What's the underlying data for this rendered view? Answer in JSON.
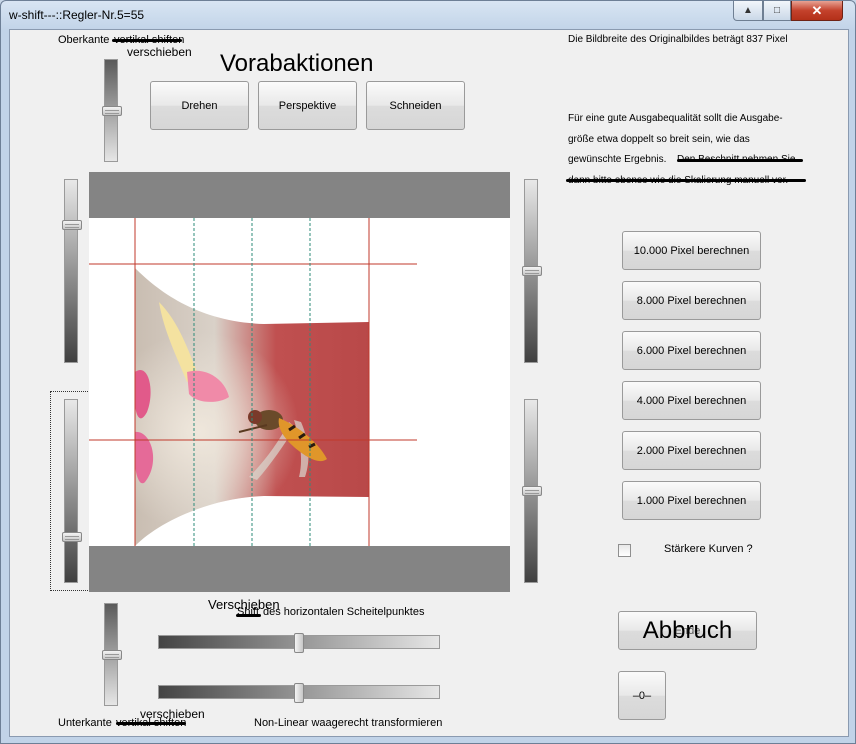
{
  "window": {
    "title": "w-shift---::Regler-Nr.5=55",
    "min_icon": "▲",
    "max_icon": "□",
    "close_icon": "✕"
  },
  "labels": {
    "oberkante": "Oberkante",
    "oberkante_strike": "vertikal shiften",
    "oberkante_new": "verschieben",
    "vorabaktionen": "Vorabaktionen",
    "info_width": "Die Bildbreite des Originalbildes beträgt 837 Pixel",
    "quality_line1": "Für eine gute Ausgabequalität sollt die Ausgabe-",
    "quality_line2": "größe etwa doppelt so breit sein, wie das",
    "quality_line3a": "gewünschte Ergebnis.",
    "quality_line3b": "Den Beschnitt nehmen Sie",
    "quality_line4": "dann bitte ebenso wie die Skalierung manuell vor.",
    "shift_new": "Verschieben",
    "shift_label_strike": "Shift",
    "shift_label_rest": "des horizontalen Scheitelpunktes",
    "unterkante": "Unterkante",
    "unterkante_strike": "vertikal shiften",
    "unterkante_new": "verschieben",
    "nonlinear": "Non-Linear waagerecht transformieren",
    "staerkere_kurven": "Stärkere Kurven ?"
  },
  "buttons": {
    "drehen": "Drehen",
    "perspektive": "Perspektive",
    "schneiden": "Schneiden",
    "px10000": "10.000 Pixel berechnen",
    "px8000": "8.000 Pixel berechnen",
    "px6000": "6.000 Pixel berechnen",
    "px4000": "4.000 Pixel berechnen",
    "px2000": "2.000 Pixel berechnen",
    "px1000": "1.000 Pixel berechnen",
    "abbruch": "Abbruch",
    "abbruch_under": "Ende",
    "reset": "–0–"
  },
  "sliders": {
    "top_vertical_level": 0.5,
    "left_upper_level": 0.23,
    "left_lower_level": 0.77,
    "right_upper_level": 0.5,
    "right_lower_level": 0.5,
    "bottom_vertical_level": 0.5,
    "h_shift_level": 0.5,
    "h_nonlinear_level": 0.5
  },
  "checkbox": {
    "staerkere_kurven_checked": false
  },
  "colors": {
    "guide_red": "#c0392b",
    "guide_teal": "#2e8b7a",
    "band_gray": "#848484"
  }
}
